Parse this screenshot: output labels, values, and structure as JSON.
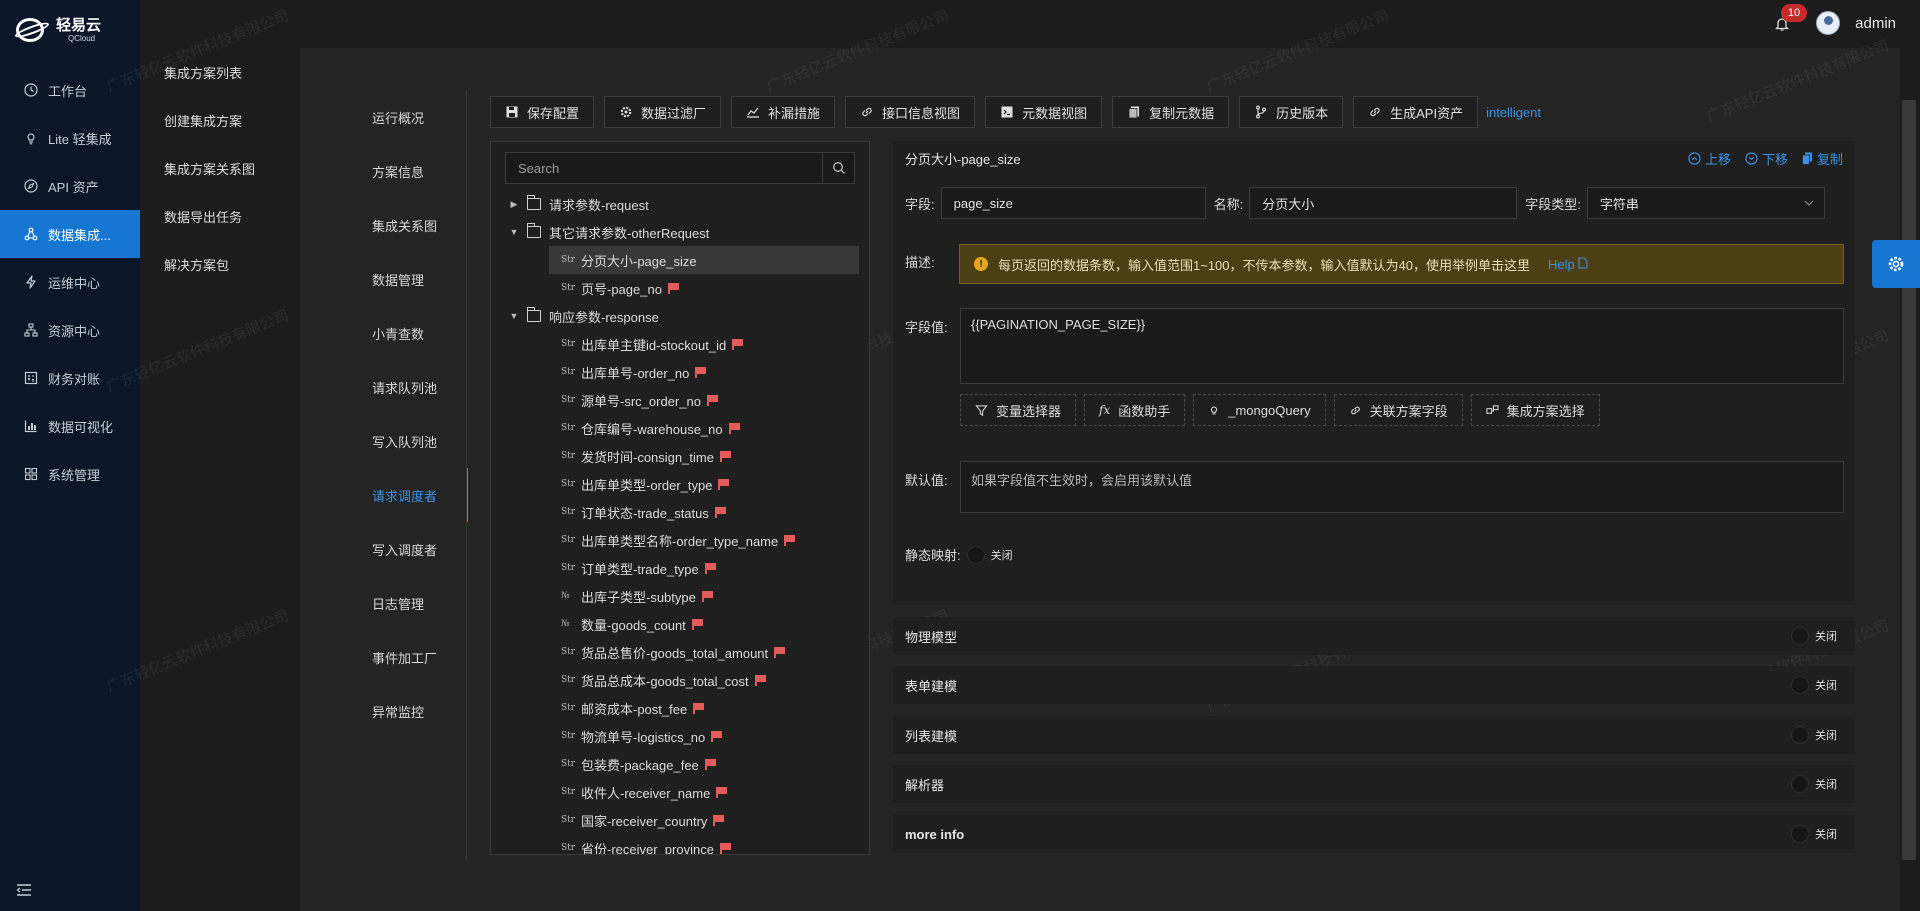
{
  "brand": {
    "name_cn": "轻易云",
    "name_en": "QCloud"
  },
  "nav": {
    "items": [
      {
        "label": "工作台",
        "icon": "clock-icon"
      },
      {
        "label": "Lite 轻集成",
        "icon": "bulb-icon"
      },
      {
        "label": "API 资产",
        "icon": "compass-icon"
      },
      {
        "label": "数据集成...",
        "icon": "network-icon",
        "active": true
      },
      {
        "label": "运维中心",
        "icon": "bolt-icon"
      },
      {
        "label": "资源中心",
        "icon": "hierarchy-icon"
      },
      {
        "label": "财务对账",
        "icon": "calculator-icon"
      },
      {
        "label": "数据可视化",
        "icon": "bar-chart-icon"
      },
      {
        "label": "系统管理",
        "icon": "grid-icon"
      }
    ]
  },
  "submenu": {
    "items": [
      "集成方案列表",
      "创建集成方案",
      "集成方案关系图",
      "数据导出任务",
      "解决方案包"
    ]
  },
  "header": {
    "notif_count": "10",
    "user": "admin"
  },
  "tabs": {
    "items": [
      "运行概况",
      "方案信息",
      "集成关系图",
      "数据管理",
      "小青查数",
      "请求队列池",
      "写入队列池",
      "请求调度者",
      "写入调度者",
      "日志管理",
      "事件加工厂",
      "异常监控"
    ],
    "active_index": 7
  },
  "toolbar": {
    "buttons": [
      {
        "label": "保存配置",
        "icon": "save-icon"
      },
      {
        "label": "数据过滤厂",
        "icon": "gear-icon"
      },
      {
        "label": "补漏措施",
        "icon": "trend-icon"
      },
      {
        "label": "接口信息视图",
        "icon": "link-icon"
      },
      {
        "label": "元数据视图",
        "icon": "terminal-icon"
      },
      {
        "label": "复制元数据",
        "icon": "copy-icon"
      },
      {
        "label": "历史版本",
        "icon": "branch-icon"
      },
      {
        "label": "生成API资产",
        "icon": "link-icon"
      }
    ],
    "link": "intelligent"
  },
  "tree": {
    "search_placeholder": "Search",
    "groups": [
      {
        "label": "请求参数-request",
        "expanded": false
      },
      {
        "label": "其它请求参数-otherRequest",
        "expanded": true
      },
      {
        "label": "响应参数-response",
        "expanded": true
      }
    ],
    "other_children": [
      {
        "type": "Str",
        "label": "分页大小-page_size",
        "flag": false,
        "selected": true
      },
      {
        "type": "Str",
        "label": "页号-page_no",
        "flag": true
      }
    ],
    "response_children": [
      {
        "type": "Str",
        "label": "出库单主键id-stockout_id"
      },
      {
        "type": "Str",
        "label": "出库单号-order_no"
      },
      {
        "type": "Str",
        "label": "源单号-src_order_no"
      },
      {
        "type": "Str",
        "label": "仓库编号-warehouse_no"
      },
      {
        "type": "Str",
        "label": "发货时间-consign_time"
      },
      {
        "type": "Str",
        "label": "出库单类型-order_type"
      },
      {
        "type": "Str",
        "label": "订单状态-trade_status"
      },
      {
        "type": "Str",
        "label": "出库单类型名称-order_type_name"
      },
      {
        "type": "Str",
        "label": "订单类型-trade_type"
      },
      {
        "type": "№",
        "label": "出库子类型-subtype"
      },
      {
        "type": "№",
        "label": "数量-goods_count"
      },
      {
        "type": "Str",
        "label": "货品总售价-goods_total_amount"
      },
      {
        "type": "Str",
        "label": "货品总成本-goods_total_cost"
      },
      {
        "type": "Str",
        "label": "邮资成本-post_fee"
      },
      {
        "type": "Str",
        "label": "物流单号-logistics_no"
      },
      {
        "type": "Str",
        "label": "包装费-package_fee"
      },
      {
        "type": "Str",
        "label": "收件人-receiver_name"
      },
      {
        "type": "Str",
        "label": "国家-receiver_country"
      },
      {
        "type": "Str",
        "label": "省份-receiver_province"
      }
    ]
  },
  "detail": {
    "title": "分页大小-page_size",
    "actions": {
      "up": "上移",
      "down": "下移",
      "copy": "复制"
    },
    "field_label": "字段:",
    "field_value": "page_size",
    "name_label": "名称:",
    "name_value": "分页大小",
    "type_label": "字段类型:",
    "type_value": "字符串",
    "desc_label": "描述:",
    "desc_text": "每页返回的数据条数，输入值范围1~100，不传本参数，输入值默认为40，使用举例单击这里",
    "help_link": "Help",
    "value_label": "字段值:",
    "value_text": "{{PAGINATION_PAGE_SIZE}}",
    "helpers": [
      {
        "label": "变量选择器",
        "icon": "filter-icon"
      },
      {
        "label": "函数助手",
        "icon": "fx-icon"
      },
      {
        "label": "_mongoQuery",
        "icon": "bulb-icon"
      },
      {
        "label": "关联方案字段",
        "icon": "link-icon"
      },
      {
        "label": "集成方案选择",
        "icon": "flow-icon"
      }
    ],
    "default_label": "默认值:",
    "default_placeholder": "如果字段值不生效时，会启用该默认值",
    "static_label": "静态映射:",
    "static_toggle": "关闭"
  },
  "sections": [
    {
      "label": "物理模型",
      "toggle": "关闭"
    },
    {
      "label": "表单建模",
      "toggle": "关闭"
    },
    {
      "label": "列表建模",
      "toggle": "关闭"
    },
    {
      "label": "解析器",
      "toggle": "关闭"
    },
    {
      "label": "more info",
      "toggle": "关闭"
    }
  ],
  "watermark": "广东轻亿云软件科技有限公司",
  "colors": {
    "accent": "#1677d3",
    "link": "#3b91e6",
    "flag": "#e35b5b",
    "warning_bg": "#4b3f13"
  }
}
